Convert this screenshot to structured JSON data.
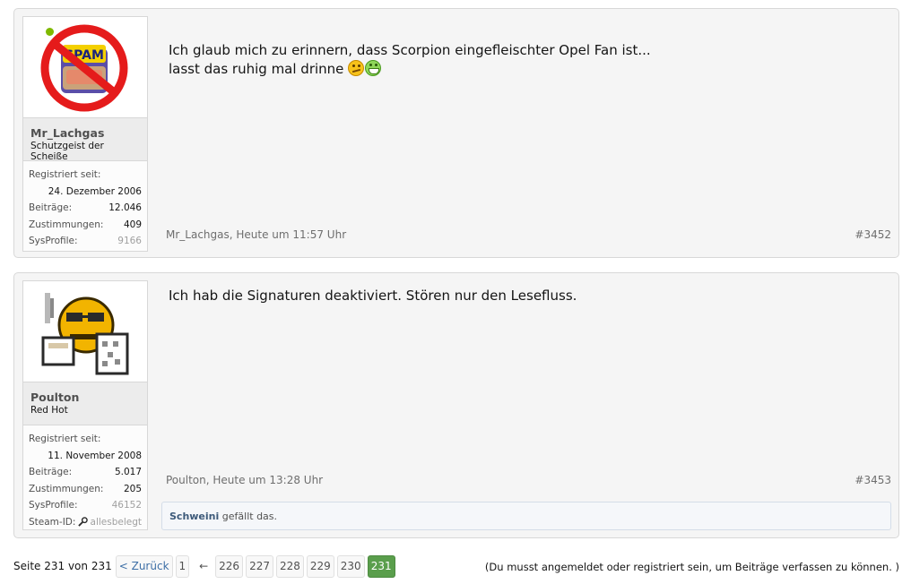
{
  "posts": [
    {
      "user": {
        "name": "Mr_Lachgas",
        "title": "Schutzgeist der Scheiße",
        "online": true
      },
      "stats": {
        "registered_label": "Registriert seit:",
        "registered_value": "24. Dezember 2006",
        "posts_label": "Beiträge:",
        "posts_value": "12.046",
        "likes_label": "Zustimmungen:",
        "likes_value": "409",
        "sysprofile_label": "SysProfile:",
        "sysprofile_value": "9166"
      },
      "message_line1": "Ich glaub mich zu erinnern, dass Scorpion eingefleischter Opel Fan ist...",
      "message_line2": "lasst das ruhig mal drinne",
      "meta": {
        "author_time": "Mr_Lachgas, Heute um 11:57 Uhr",
        "number": "#3452"
      }
    },
    {
      "user": {
        "name": "Poulton",
        "title": "Red Hot",
        "online": false
      },
      "stats": {
        "registered_label": "Registriert seit:",
        "registered_value": "11. November 2008",
        "posts_label": "Beiträge:",
        "posts_value": "5.017",
        "likes_label": "Zustimmungen:",
        "likes_value": "205",
        "sysprofile_label": "SysProfile:",
        "sysprofile_value": "46152",
        "steam_label": "Steam-ID:",
        "steam_value": "allesbelegt"
      },
      "message_line1": "Ich hab die Signaturen deaktiviert. Stören nur den Lesefluss.",
      "meta": {
        "author_time": "Poulton, Heute um 13:28 Uhr",
        "number": "#3453"
      },
      "likes": {
        "user": "Schweini",
        "text": " gefällt das."
      }
    }
  ],
  "pagination": {
    "label": "Seite 231 von 231",
    "prev": "< Zurück",
    "first": "1",
    "gap": "←",
    "pages": [
      "226",
      "227",
      "228",
      "229",
      "230",
      "231"
    ],
    "current": "231"
  },
  "notice": "(Du musst angemeldet oder registriert sein, um Beiträge verfassen zu können. )"
}
